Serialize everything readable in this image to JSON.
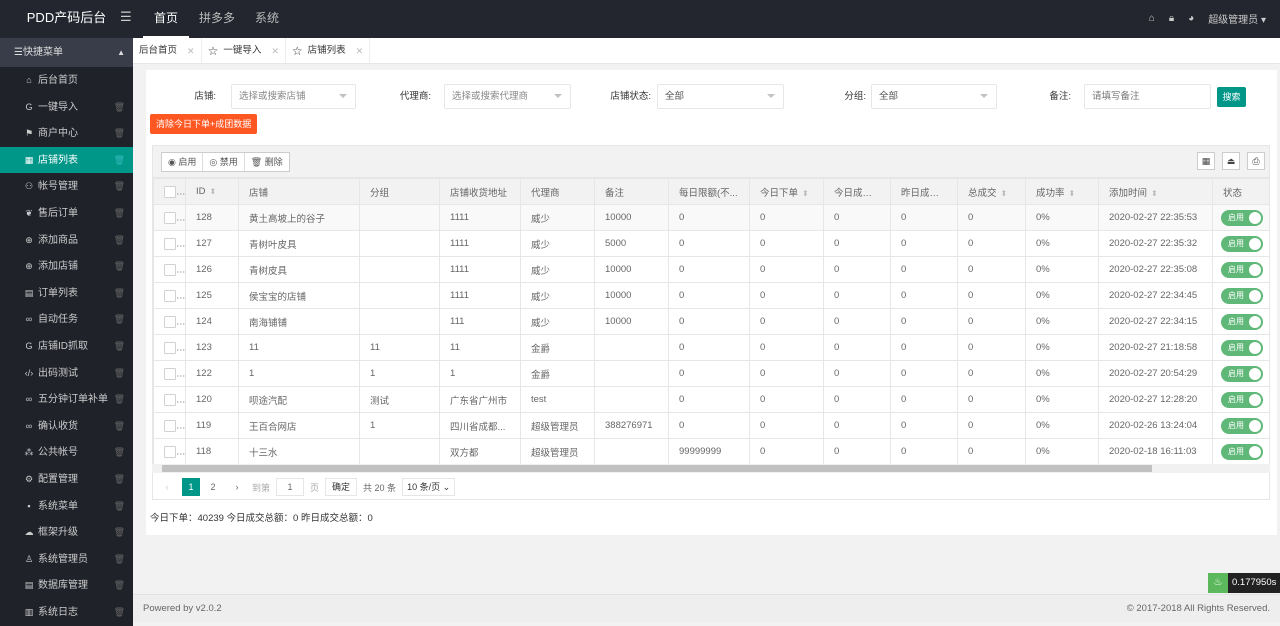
{
  "header": {
    "logo": "PDD产码后台",
    "nav": [
      {
        "label": "首页",
        "active": true
      },
      {
        "label": "拼多多"
      },
      {
        "label": "系统"
      }
    ],
    "user": "超级管理员"
  },
  "sidebar": {
    "title": "快捷菜单",
    "items": [
      {
        "label": "后台首页",
        "icon": "home-icon",
        "glyph": "⌂",
        "trash": false
      },
      {
        "label": "一键导入",
        "icon": "google-icon",
        "glyph": "G",
        "trash": true
      },
      {
        "label": "商户中心",
        "icon": "flag-icon",
        "glyph": "⚑",
        "trash": true
      },
      {
        "label": "店铺列表",
        "icon": "grid-icon",
        "glyph": "▦",
        "trash": true,
        "active": true
      },
      {
        "label": "帐号管理",
        "icon": "users-icon",
        "glyph": "⚇",
        "trash": true
      },
      {
        "label": "售后订单",
        "icon": "gift-icon",
        "glyph": "❦",
        "trash": true
      },
      {
        "label": "添加商品",
        "icon": "add-circle-icon",
        "glyph": "⊕",
        "trash": true
      },
      {
        "label": "添加店铺",
        "icon": "add-circle-icon",
        "glyph": "⊕",
        "trash": true
      },
      {
        "label": "订单列表",
        "icon": "list-icon",
        "glyph": "▤",
        "trash": true
      },
      {
        "label": "自动任务",
        "icon": "link-icon",
        "glyph": "∞",
        "trash": true
      },
      {
        "label": "店铺ID抓取",
        "icon": "google-icon",
        "glyph": "G",
        "trash": true
      },
      {
        "label": "出码测试",
        "icon": "code-icon",
        "glyph": "‹/›",
        "trash": true
      },
      {
        "label": "五分钟订单补单",
        "icon": "link-icon",
        "glyph": "∞",
        "trash": true
      },
      {
        "label": "确认收货",
        "icon": "link-icon",
        "glyph": "∞",
        "trash": true
      },
      {
        "label": "公共帐号",
        "icon": "apps-icon",
        "glyph": "⁂",
        "trash": true
      },
      {
        "label": "配置管理",
        "icon": "settings-icon",
        "glyph": "⚙",
        "trash": true
      },
      {
        "label": "系统菜单",
        "icon": "menu-icon",
        "glyph": "▪",
        "trash": true
      },
      {
        "label": "框架升级",
        "icon": "cloud-icon",
        "glyph": "☁",
        "trash": true
      },
      {
        "label": "系统管理员",
        "icon": "user-icon",
        "glyph": "♙",
        "trash": true
      },
      {
        "label": "数据库管理",
        "icon": "database-icon",
        "glyph": "▤",
        "trash": true
      },
      {
        "label": "系统日志",
        "icon": "log-icon",
        "glyph": "▥",
        "trash": true
      }
    ]
  },
  "tabs": [
    {
      "label": "后台首页",
      "star": false
    },
    {
      "label": "一键导入",
      "star": true
    },
    {
      "label": "店铺列表",
      "star": true,
      "active": true
    }
  ],
  "filters": {
    "shop_label": "店铺:",
    "shop_placeholder": "选择或搜索店铺",
    "agent_label": "代理商:",
    "agent_placeholder": "选择或搜索代理商",
    "status_label": "店铺状态:",
    "status_value": "全部",
    "group_label": "分组:",
    "group_value": "全部",
    "remark_label": "备注:",
    "remark_placeholder": "请填写备注",
    "search": "搜索",
    "clear": "清除今日下单+成团数据"
  },
  "toolbar": {
    "enable": "启用",
    "disable": "禁用",
    "delete": "删除"
  },
  "table": {
    "columns": [
      {
        "label": "",
        "w": 32
      },
      {
        "label": "ID",
        "sort": true,
        "w": 53
      },
      {
        "label": "店铺",
        "w": 121
      },
      {
        "label": "分组",
        "w": 80
      },
      {
        "label": "店铺收货地址",
        "w": 81
      },
      {
        "label": "代理商",
        "w": 74
      },
      {
        "label": "备注",
        "w": 74
      },
      {
        "label": "每日限额(不...",
        "w": 81
      },
      {
        "label": "今日下单",
        "sort": true,
        "w": 74
      },
      {
        "label": "今日成交...",
        "sort": true,
        "w": 67
      },
      {
        "label": "昨日成交...",
        "sort": true,
        "w": 67
      },
      {
        "label": "总成交",
        "sort": true,
        "w": 68
      },
      {
        "label": "成功率",
        "sort": true,
        "w": 73
      },
      {
        "label": "添加时间",
        "sort": true,
        "w": 114
      },
      {
        "label": "状态",
        "w": 81
      }
    ],
    "rows": [
      [
        "128",
        "黄土高坡上的谷子",
        "",
        "1111",
        "威少",
        "10000",
        "0",
        "0",
        "0",
        "0",
        "0",
        "0%",
        "2020-02-27 22:35:53"
      ],
      [
        "127",
        "青树叶皮具",
        "",
        "1111",
        "威少",
        "5000",
        "0",
        "0",
        "0",
        "0",
        "0",
        "0%",
        "2020-02-27 22:35:32"
      ],
      [
        "126",
        "青树皮具",
        "",
        "1111",
        "威少",
        "10000",
        "0",
        "0",
        "0",
        "0",
        "0",
        "0%",
        "2020-02-27 22:35:08"
      ],
      [
        "125",
        "侯宝宝的店铺",
        "",
        "1111",
        "威少",
        "10000",
        "0",
        "0",
        "0",
        "0",
        "0",
        "0%",
        "2020-02-27 22:34:45"
      ],
      [
        "124",
        "南海铺铺",
        "",
        "111",
        "威少",
        "10000",
        "0",
        "0",
        "0",
        "0",
        "0",
        "0%",
        "2020-02-27 22:34:15"
      ],
      [
        "123",
        "11",
        "11",
        "11",
        "金爵",
        "",
        "0",
        "0",
        "0",
        "0",
        "0",
        "0%",
        "2020-02-27 21:18:58"
      ],
      [
        "122",
        "1",
        "1",
        "1",
        "金爵",
        "",
        "0",
        "0",
        "0",
        "0",
        "0",
        "0%",
        "2020-02-27 20:54:29"
      ],
      [
        "120",
        "呗途汽配",
        "测试",
        "广东省广州市",
        "test",
        "",
        "0",
        "0",
        "0",
        "0",
        "0",
        "0%",
        "2020-02-27 12:28:20"
      ],
      [
        "119",
        "王百合网店",
        "1",
        "四川省成都...",
        "超级管理员",
        "388276971",
        "0",
        "0",
        "0",
        "0",
        "0",
        "0%",
        "2020-02-26 13:24:04"
      ],
      [
        "118",
        "十三水",
        "",
        "双方都",
        "超级管理员",
        "",
        "99999999",
        "0",
        "0",
        "0",
        "0",
        "0%",
        "2020-02-18 16:11:03"
      ]
    ],
    "status_label": "启用"
  },
  "pagination": {
    "current": "1",
    "pages": [
      "1",
      "2"
    ],
    "goto_label": "到第",
    "goto_value": "1",
    "page_unit": "页",
    "confirm": "确定",
    "total": "共 20 条",
    "per_page": "10 条/页"
  },
  "summary": "今日下单：40239 今日成交总额：0 昨日成交总额：0",
  "footer": {
    "left": "Powered by v2.0.2",
    "right": "© 2017-2018 All Rights Reserved."
  },
  "timer": "0.177950s",
  "colors": {
    "accent": "#009688",
    "danger": "#ff5722",
    "switch": "#5fb878",
    "header": "#23262e"
  }
}
